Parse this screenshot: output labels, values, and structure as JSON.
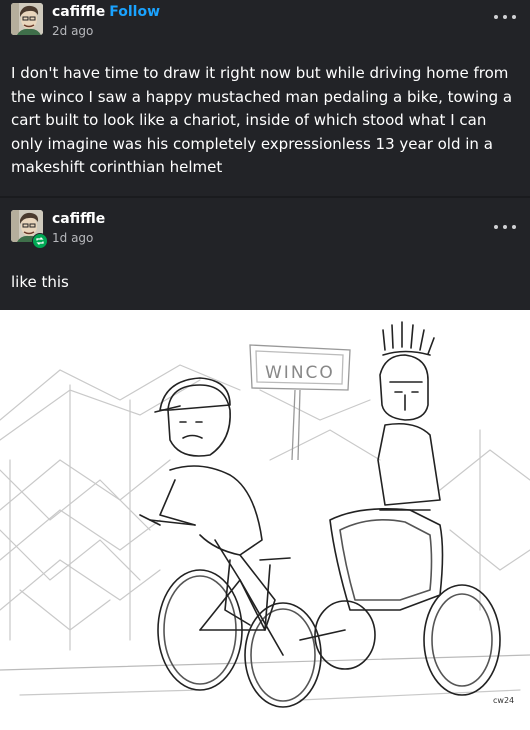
{
  "posts": [
    {
      "username": "cafiffle",
      "follow_label": "Follow",
      "timestamp": "2d ago",
      "body": "I don't have time to draw it right now but while driving home from the winco I saw a happy mustached man pedaling a bike, towing a cart built to look like a chariot, inside of which stood what I can only imagine was his completely expressionless 13 year old in a makeshift corinthian helmet",
      "more_icon": "ellipsis-icon"
    },
    {
      "username": "cafiffle",
      "timestamp": "1d ago",
      "reblog_icon": "reblog-icon",
      "body": "like this",
      "more_icon": "ellipsis-icon"
    }
  ],
  "drawing": {
    "sign_text": "WINCO",
    "signature": "cw24"
  },
  "colors": {
    "background": "#222327",
    "text": "#ffffff",
    "muted": "#b7b8bc",
    "follow": "#1aa3ff",
    "reblog_badge": "#00a854"
  }
}
